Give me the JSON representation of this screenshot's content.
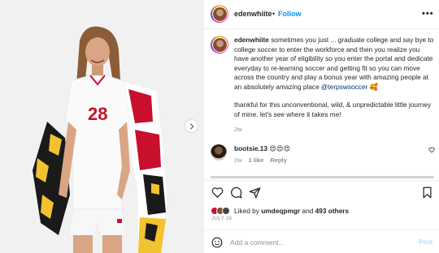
{
  "post": {
    "author": "edenwhiite",
    "separator": "•",
    "follow_label": "Follow",
    "more_label": "•••",
    "caption_line1": "sometimes you just ... graduate college and say bye to college soccer to enter the workforce and then you realize you have another year of eligibility so you enter the portal and dedicate everyday to re-learning soccer and getting fit so you can move across the country and play a bonus year with amazing people at an absolutely amazing place",
    "caption_mention": "@terpswsoccer",
    "caption_emoji": "🥰",
    "caption_line2": "thankful for this unconventional, wild, & unpredictable little journey of mine. let's see where it takes me!",
    "caption_time": "2w",
    "jersey_number": "28"
  },
  "comments": [
    {
      "username": "bootsie.13",
      "text": "😍😍😍",
      "time": "2w",
      "likes": "1 like",
      "reply_label": "Reply"
    }
  ],
  "likes": {
    "prefix": "Liked by",
    "user": "umdeqpmgr",
    "connector": "and",
    "others": "493 others"
  },
  "date": "JULY 28",
  "comment_input": {
    "placeholder": "Add a comment...",
    "post_label": "Post"
  },
  "icons": {
    "next": "chevron-right-icon",
    "more": "more-options-icon",
    "like": "heart-icon",
    "comment": "comment-icon",
    "share": "share-icon",
    "save": "bookmark-icon",
    "emoji": "emoji-icon"
  },
  "colors": {
    "follow": "#0095f6",
    "mention": "#00376b",
    "muted": "#8e8e8e",
    "post_disabled": "#b2dffc",
    "maryland_red": "#c8102e",
    "maryland_gold": "#f2c230"
  }
}
